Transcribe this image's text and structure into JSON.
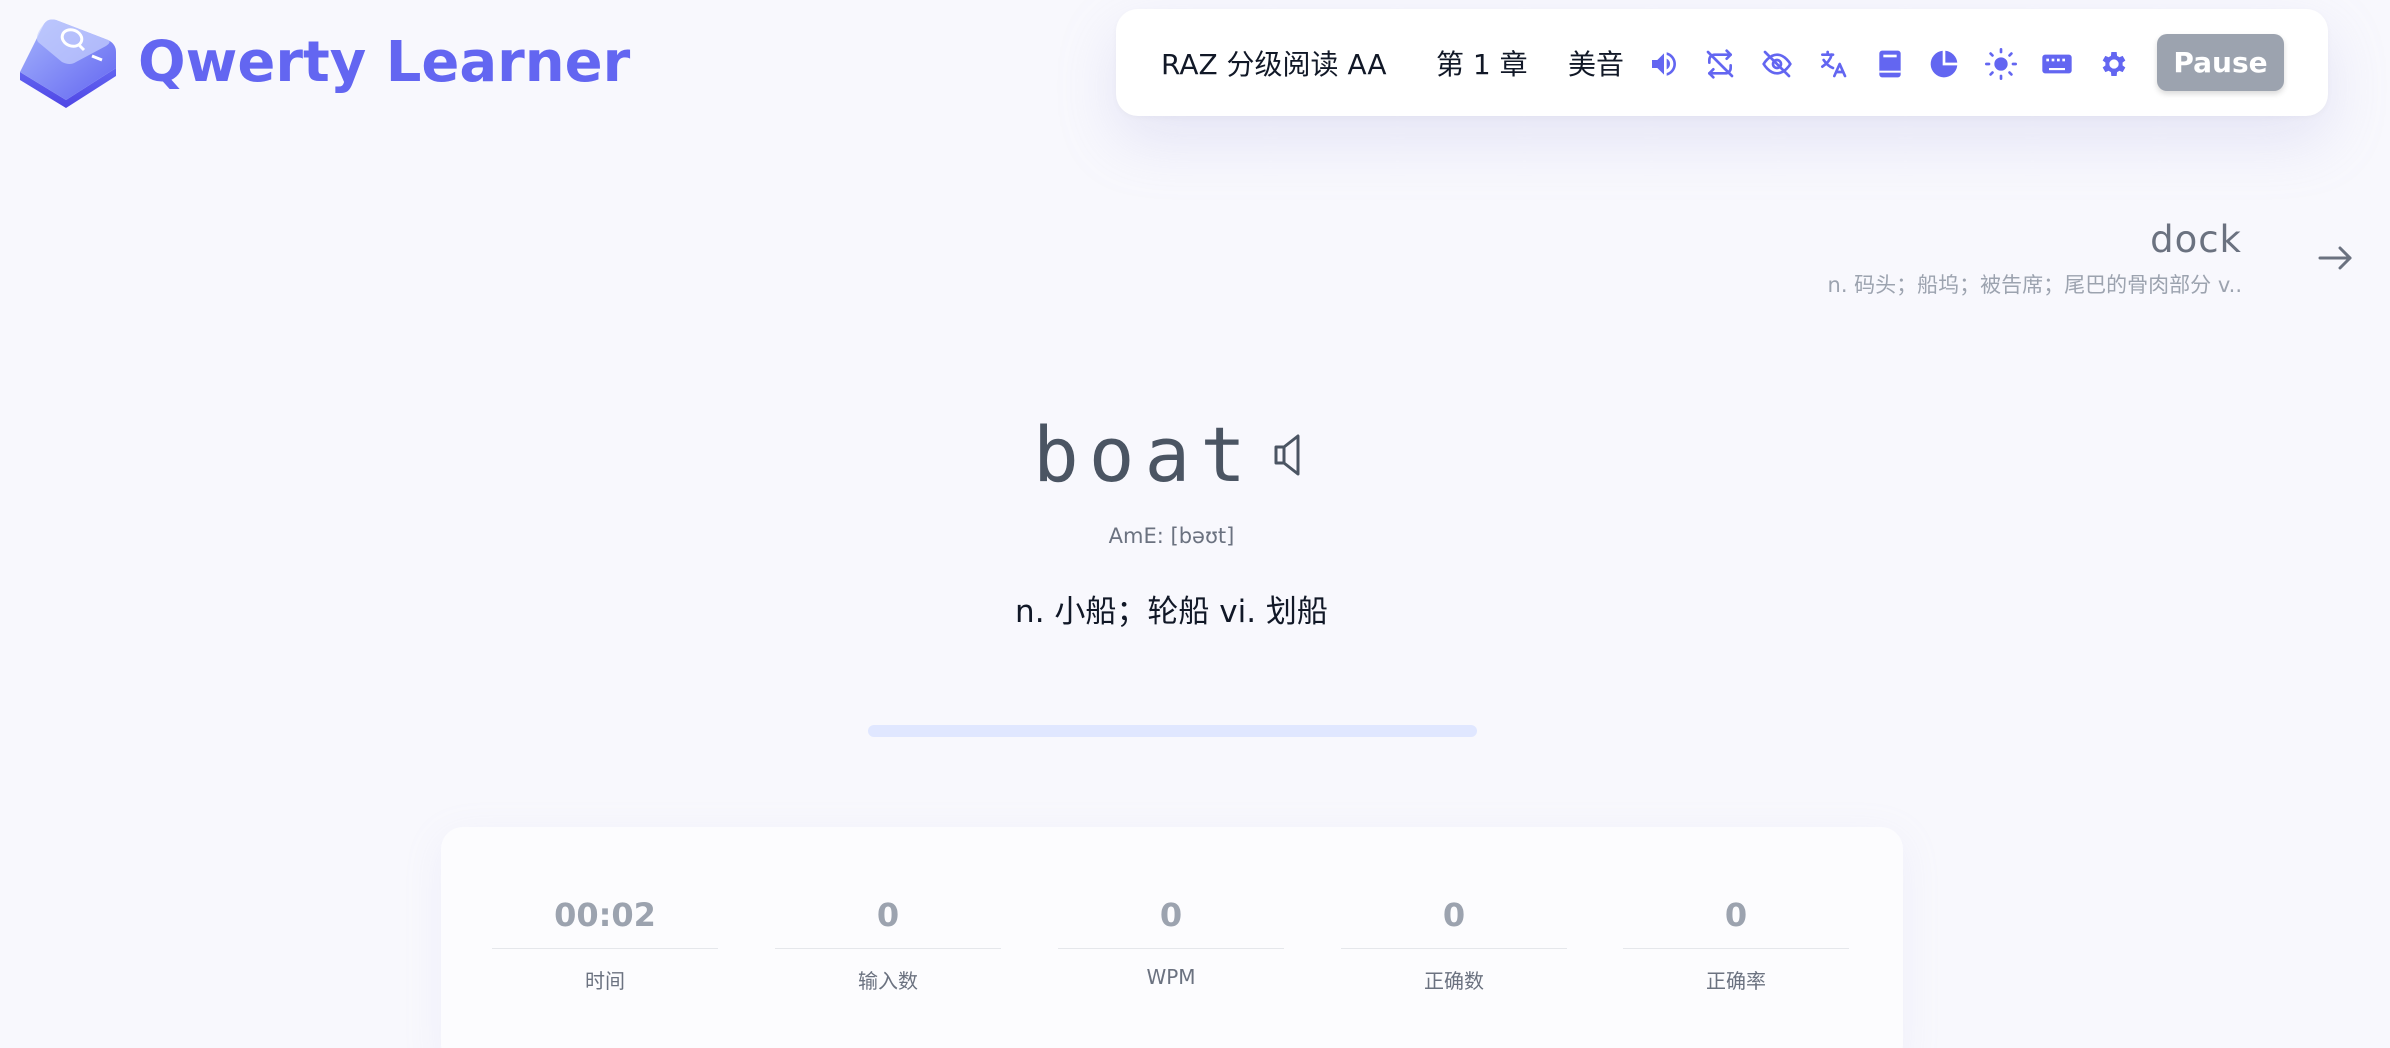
{
  "app": {
    "title": "Qwerty Learner",
    "accent_color": "#6366f1"
  },
  "toolbar": {
    "dictionary": "RAZ 分级阅读 AA",
    "chapter": "第 1 章",
    "pronunciation": "美音",
    "icons": [
      "sound-icon",
      "loop-icon",
      "hide-word-icon",
      "translation-icon",
      "dictation-icon",
      "analysis-icon",
      "theme-icon",
      "keyboard-icon",
      "settings-icon"
    ],
    "pause_label": "Pause"
  },
  "next_word": {
    "word": "dock",
    "translation": "n. 码头；船坞；被告席；尾巴的骨肉部分 v.."
  },
  "current_word": {
    "word": "boat",
    "phonetic": "AmE: [bəʊt]",
    "translation": "n. 小船；轮船 vi. 划船",
    "progress": 0
  },
  "stats": [
    {
      "value": "00:02",
      "label": "时间"
    },
    {
      "value": "0",
      "label": "输入数"
    },
    {
      "value": "0",
      "label": "WPM"
    },
    {
      "value": "0",
      "label": "正确数"
    },
    {
      "value": "0",
      "label": "正确率"
    }
  ]
}
